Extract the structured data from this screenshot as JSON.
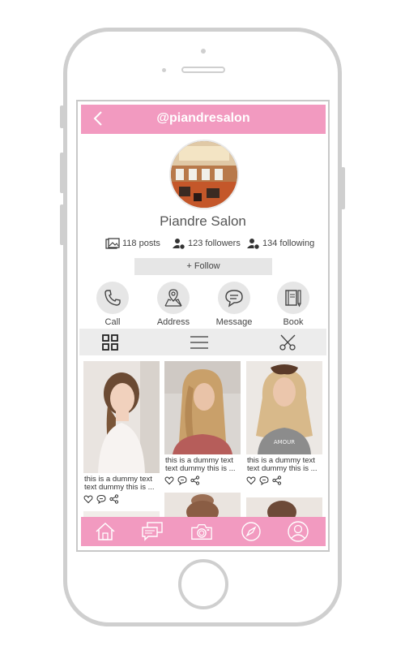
{
  "header": {
    "title": "@piandresalon"
  },
  "profile": {
    "name": "Piandre Salon",
    "posts": "118 posts",
    "followers": "123 followers",
    "following": "134 following",
    "follow_label": "+ Follow"
  },
  "actions": [
    {
      "label": "Call",
      "icon": "phone-icon"
    },
    {
      "label": "Address",
      "icon": "map-pin-icon"
    },
    {
      "label": "Message",
      "icon": "chat-bubble-icon"
    },
    {
      "label": "Book",
      "icon": "notebook-icon"
    }
  ],
  "view_tabs": [
    "grid-icon",
    "list-icon",
    "scissors-icon"
  ],
  "posts": [
    {
      "caption1": "this is a dummy text",
      "caption2": "text dummy this is ..."
    },
    {
      "caption1": "this is a dummy text",
      "caption2": "text dummy this is ..."
    },
    {
      "caption1": "this is a dummy text",
      "caption2": "text dummy this is ..."
    }
  ],
  "bottom_nav": [
    "home-icon",
    "messages-icon",
    "camera-icon",
    "compass-icon",
    "profile-icon"
  ],
  "colors": {
    "accent": "#f29ac0",
    "panel": "#e6e6e6",
    "frame": "#cfcfcf"
  }
}
